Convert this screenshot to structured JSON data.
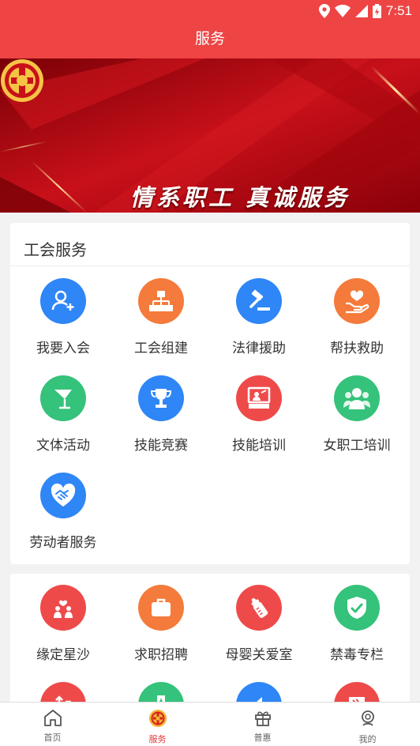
{
  "status": {
    "time": "7:51"
  },
  "header": {
    "title": "服务"
  },
  "banner": {
    "slogan": "情系职工 真诚服务"
  },
  "union_services": {
    "title": "工会服务",
    "items": [
      {
        "label": "我要入会",
        "icon": "person-add-icon",
        "color": "#2f86f6"
      },
      {
        "label": "工会组建",
        "icon": "org-chart-icon",
        "color": "#f47b3b"
      },
      {
        "label": "法律援助",
        "icon": "gavel-icon",
        "color": "#2f86f6"
      },
      {
        "label": "帮扶救助",
        "icon": "heart-hand-icon",
        "color": "#f47b3b"
      },
      {
        "label": "文体活动",
        "icon": "flag-icon",
        "color": "#35c27a"
      },
      {
        "label": "技能竞赛",
        "icon": "trophy-icon",
        "color": "#2f86f6"
      },
      {
        "label": "技能培训",
        "icon": "training-board-icon",
        "color": "#ef4a4a"
      },
      {
        "label": "女职工培训",
        "icon": "women-group-icon",
        "color": "#35c27a"
      },
      {
        "label": "劳动者服务",
        "icon": "handshake-heart-icon",
        "color": "#2f86f6"
      }
    ]
  },
  "more_services": {
    "items": [
      {
        "label": "缘定星沙",
        "icon": "couple-balloon-icon",
        "color": "#ef4a4a"
      },
      {
        "label": "求职招聘",
        "icon": "briefcase-icon",
        "color": "#f47b3b"
      },
      {
        "label": "母婴关爱室",
        "icon": "baby-bottle-icon",
        "color": "#ef4a4a"
      },
      {
        "label": "禁毒专栏",
        "icon": "shield-icon",
        "color": "#35c27a"
      },
      {
        "label": "",
        "icon": "red-service-icon",
        "color": "#ef4a4a"
      },
      {
        "label": "",
        "icon": "green-service-icon",
        "color": "#35c27a"
      },
      {
        "label": "",
        "icon": "blue-service-icon",
        "color": "#2f86f6"
      },
      {
        "label": "",
        "icon": "party-flag-icon",
        "color": "#ef4a4a"
      }
    ]
  },
  "tabbar": {
    "items": [
      {
        "label": "首页",
        "icon": "home-icon",
        "active": false
      },
      {
        "label": "服务",
        "icon": "union-emblem-icon",
        "active": true
      },
      {
        "label": "普惠",
        "icon": "gift-icon",
        "active": false
      },
      {
        "label": "我的",
        "icon": "profile-icon",
        "active": false
      }
    ]
  },
  "colors": {
    "primary": "#ee4444",
    "active_tab": "#e53935"
  }
}
